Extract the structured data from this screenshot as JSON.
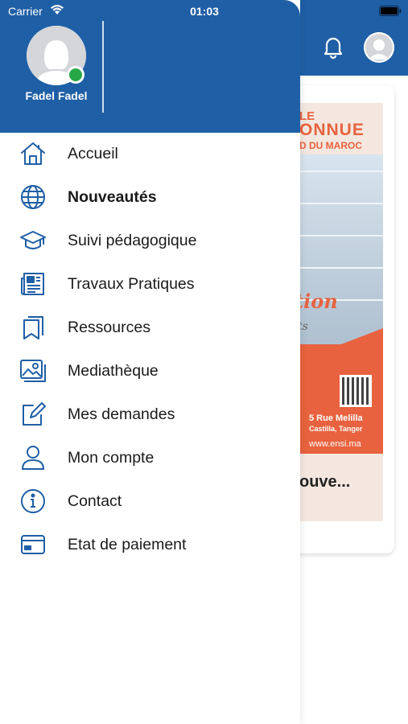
{
  "status_bar": {
    "carrier": "Carrier",
    "time": "01:03"
  },
  "profile": {
    "name": "Fadel Fadel",
    "online_color": "#27a844"
  },
  "colors": {
    "primary": "#1f5fa6",
    "accent_orange": "#e8623f"
  },
  "menu": {
    "items": [
      {
        "label": "Accueil",
        "icon": "home-icon",
        "active": false
      },
      {
        "label": "Nouveautés",
        "icon": "globe-icon",
        "active": true
      },
      {
        "label": "Suivi pédagogique",
        "icon": "graduation-cap-icon",
        "active": false
      },
      {
        "label": "Travaux Pratiques",
        "icon": "newspaper-icon",
        "active": false
      },
      {
        "label": "Ressources",
        "icon": "bookmarks-icon",
        "active": false
      },
      {
        "label": "Mediathèque",
        "icon": "images-icon",
        "active": false
      },
      {
        "label": "Mes demandes",
        "icon": "edit-icon",
        "active": false
      },
      {
        "label": "Mon compte",
        "icon": "user-icon",
        "active": false
      },
      {
        "label": "Contact",
        "icon": "info-icon",
        "active": false
      },
      {
        "label": "Etat de paiement",
        "icon": "credit-card-icon",
        "active": false
      }
    ]
  },
  "background": {
    "banner": {
      "line1": "LE",
      "line2": "ONNUE",
      "line3": "D DU MAROC",
      "script": "tion",
      "script2": "ts",
      "address1": "5 Rue Melilla",
      "address2": "Castilla, Tanger",
      "website": "www.ensi.ma"
    },
    "card_title": "ouve..."
  }
}
